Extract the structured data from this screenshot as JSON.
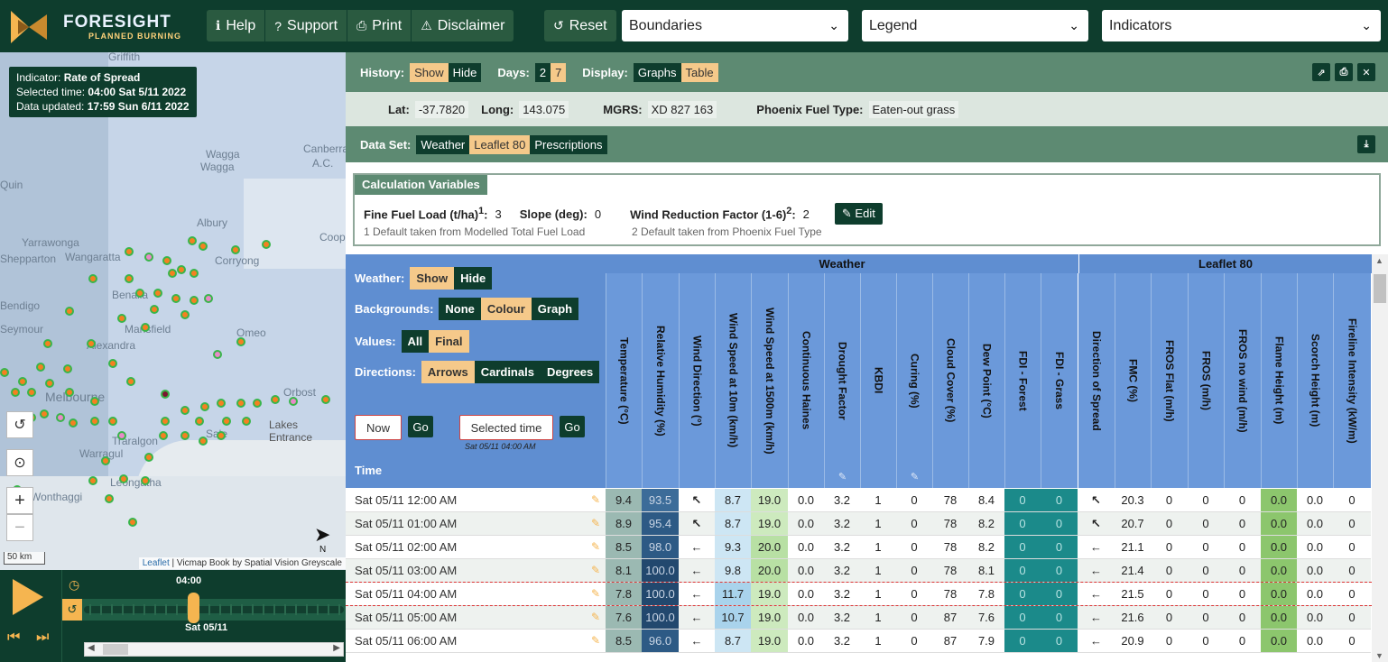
{
  "topbar": {
    "brand": "FORESIGHT",
    "brand_sub": "PLANNED BURNING",
    "buttons": [
      "Help",
      "Support",
      "Print",
      "Disclaimer"
    ],
    "reset": "Reset",
    "selects": [
      "Boundaries",
      "Legend",
      "Indicators"
    ]
  },
  "map": {
    "indicator_label": "Indicator:",
    "indicator_value": "Rate of Spread",
    "selected_label": "Selected time:",
    "selected_value": "04:00 Sat 5/11 2022",
    "updated_label": "Data updated:",
    "updated_value": "17:59 Sun 6/11 2022",
    "labels": [
      "Griffith",
      "Wagga",
      "Wagga",
      "Canberra",
      "A.C.",
      "Albury",
      "Corryong",
      "Yarrawonga",
      "Wangaratta",
      "Shepparton",
      "Benalla",
      "Mansfield",
      "Omeo",
      "Bendigo",
      "Seymour",
      "Alexandra",
      "Orbost",
      "Melbourne",
      "Lakes",
      "Entrance",
      "Traralgon",
      "Sale",
      "Warragul",
      "Leongatha",
      "Wonthaggi",
      "Coop",
      "Quin"
    ],
    "scale": "50 km",
    "attribution_link": "Leaflet",
    "attribution_text": " | Vicmap Book by Spatial Vision Greyscale",
    "north": "N"
  },
  "timeline": {
    "time": "04:00",
    "date": "Sat 05/11"
  },
  "history": {
    "label": "History:",
    "options": [
      "Show",
      "Hide"
    ],
    "selected": "Show",
    "days_label": "Days:",
    "days": [
      "2",
      "7"
    ],
    "days_selected": "7",
    "display_label": "Display:",
    "display_options": [
      "Graphs",
      "Table"
    ],
    "display_selected": "Table"
  },
  "location": {
    "lat_label": "Lat:",
    "lat": "-37.7820",
    "long_label": "Long:",
    "long": "143.075",
    "mgrs_label": "MGRS:",
    "mgrs": "XD 827 163",
    "fuel_label": "Phoenix Fuel Type:",
    "fuel": "Eaten-out grass"
  },
  "dataset": {
    "label": "Data Set:",
    "options": [
      "Weather",
      "Leaflet 80",
      "Prescriptions"
    ],
    "selected": "Leaflet 80"
  },
  "calc": {
    "title": "Calculation Variables",
    "ffl_label": "Fine Fuel Load (t/ha)",
    "ffl_sup": "1",
    "ffl": "3",
    "slope_label": "Slope (deg):",
    "slope": "0",
    "wrf_label": "Wind Reduction Factor (1-6)",
    "wrf_sup": "2",
    "wrf": "2",
    "edit": "Edit",
    "note1": "1 Default taken from Modelled Total Fuel Load",
    "note2": "2 Default taken from Phoenix Fuel Type"
  },
  "controls": {
    "weather_label": "Weather:",
    "weather_opts": [
      "Show",
      "Hide"
    ],
    "backgrounds_label": "Backgrounds:",
    "backgrounds_opts": [
      "None",
      "Colour",
      "Graph"
    ],
    "values_label": "Values:",
    "values_opts": [
      "All",
      "Final"
    ],
    "directions_label": "Directions:",
    "directions_opts": [
      "Arrows",
      "Cardinals",
      "Degrees"
    ],
    "now": "Now",
    "go": "Go",
    "selected_time": "Selected time",
    "selected_time_sub": "Sat 05/11 04:00 AM",
    "time_header": "Time"
  },
  "table": {
    "group_weather": "Weather",
    "group_leaflet": "Leaflet 80",
    "columns": [
      "Temperature (°C)",
      "Relative Humidity (%)",
      "Wind Direction (°)",
      "Wind Speed at 10m (km/h)",
      "Wind Speed at 1500m (km/h)",
      "Continuous Haines",
      "Drought Factor",
      "KBDI",
      "Curing (%)",
      "Cloud Cover (%)",
      "Dew Point (°C)",
      "FDI - Forest",
      "FDI - Grass",
      "Direction of Spread",
      "FMC (%)",
      "FROS Flat (m/h)",
      "FROS (m/h)",
      "FROS no wind (m/h)",
      "Flame Height (m)",
      "Scorch Height (m)",
      "Fireline Intensity (kW/m)"
    ],
    "rows": [
      {
        "time": "Sat 05/11 12:00 AM",
        "v": [
          "9.4",
          "93.5",
          "↖",
          "8.7",
          "19.0",
          "0.0",
          "3.2",
          "1",
          "0",
          "78",
          "8.4",
          "0",
          "0",
          "↖",
          "20.3",
          "0",
          "0",
          "0",
          "0.0",
          "0.0",
          "0"
        ]
      },
      {
        "time": "Sat 05/11 01:00 AM",
        "v": [
          "8.9",
          "95.4",
          "↖",
          "8.7",
          "19.0",
          "0.0",
          "3.2",
          "1",
          "0",
          "78",
          "8.2",
          "0",
          "0",
          "↖",
          "20.7",
          "0",
          "0",
          "0",
          "0.0",
          "0.0",
          "0"
        ]
      },
      {
        "time": "Sat 05/11 02:00 AM",
        "v": [
          "8.5",
          "98.0",
          "←",
          "9.3",
          "20.0",
          "0.0",
          "3.2",
          "1",
          "0",
          "78",
          "8.2",
          "0",
          "0",
          "←",
          "21.1",
          "0",
          "0",
          "0",
          "0.0",
          "0.0",
          "0"
        ]
      },
      {
        "time": "Sat 05/11 03:00 AM",
        "v": [
          "8.1",
          "100.0",
          "←",
          "9.8",
          "20.0",
          "0.0",
          "3.2",
          "1",
          "0",
          "78",
          "8.1",
          "0",
          "0",
          "←",
          "21.4",
          "0",
          "0",
          "0",
          "0.0",
          "0.0",
          "0"
        ]
      },
      {
        "time": "Sat 05/11 04:00 AM",
        "v": [
          "7.8",
          "100.0",
          "←",
          "11.7",
          "19.0",
          "0.0",
          "3.2",
          "1",
          "0",
          "78",
          "7.8",
          "0",
          "0",
          "←",
          "21.5",
          "0",
          "0",
          "0",
          "0.0",
          "0.0",
          "0"
        ]
      },
      {
        "time": "Sat 05/11 05:00 AM",
        "v": [
          "7.6",
          "100.0",
          "←",
          "10.7",
          "19.0",
          "0.0",
          "3.2",
          "1",
          "0",
          "87",
          "7.6",
          "0",
          "0",
          "←",
          "21.6",
          "0",
          "0",
          "0",
          "0.0",
          "0.0",
          "0"
        ]
      },
      {
        "time": "Sat 05/11 06:00 AM",
        "v": [
          "8.5",
          "96.0",
          "←",
          "8.7",
          "19.0",
          "0.0",
          "3.2",
          "1",
          "0",
          "87",
          "7.9",
          "0",
          "0",
          "←",
          "20.9",
          "0",
          "0",
          "0",
          "0.0",
          "0.0",
          "0"
        ]
      }
    ]
  }
}
